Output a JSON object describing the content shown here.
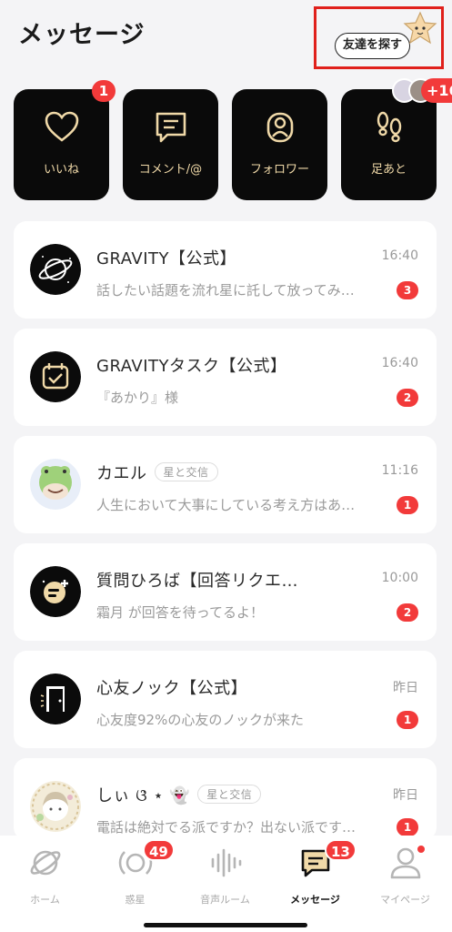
{
  "header": {
    "title": "メッセージ",
    "find_friends": "友達を探す"
  },
  "cards": [
    {
      "label": "いいね",
      "icon": "heart-icon",
      "badge": "1"
    },
    {
      "label": "コメント/@",
      "icon": "comment-icon",
      "badge": ""
    },
    {
      "label": "フォロワー",
      "icon": "follower-icon",
      "badge": ""
    },
    {
      "label": "足あと",
      "icon": "footprints-icon",
      "badge": "+16"
    }
  ],
  "messages": [
    {
      "name": "GRAVITY【公式】",
      "tag": "",
      "time": "16:40",
      "preview": "話したい話題を流れ星に託して放ってみ…",
      "count": "3"
    },
    {
      "name": "GRAVITYタスク【公式】",
      "tag": "",
      "time": "16:40",
      "preview": "『あかり』様",
      "count": "2"
    },
    {
      "name": "カエル",
      "tag": "星と交信",
      "time": "11:16",
      "preview": "人生において大事にしている考え方はあ…",
      "count": "1"
    },
    {
      "name": "質問ひろば【回答リクエ…",
      "tag": "",
      "time": "10:00",
      "preview": "霜月 が回答を待ってるよ！",
      "count": "2"
    },
    {
      "name": "心友ノック【公式】",
      "tag": "",
      "time": "昨日",
      "preview": "心友度92%の心友のノックが来た",
      "count": "1"
    },
    {
      "name": "しぃ ଓ̇ ⋆ 👻",
      "tag": "星と交信",
      "time": "昨日",
      "preview": "電話は絶対でる派ですか？出ない派です…",
      "count": "1"
    }
  ],
  "tabbar": {
    "tabs": [
      {
        "label": "ホーム",
        "icon": "planet-icon",
        "badge": ""
      },
      {
        "label": "惑星",
        "icon": "orbit-icon",
        "badge": "49"
      },
      {
        "label": "音声ルーム",
        "icon": "voice-wave-icon",
        "badge": ""
      },
      {
        "label": "メッセージ",
        "icon": "message-icon",
        "badge": "13"
      },
      {
        "label": "マイページ",
        "icon": "person-icon",
        "badge": ""
      }
    ]
  },
  "colors": {
    "accent_red": "#f23a3a",
    "card_bg": "#0a0a0a",
    "card_icon": "#f0d9a8",
    "highlight_box": "#e0201b"
  }
}
